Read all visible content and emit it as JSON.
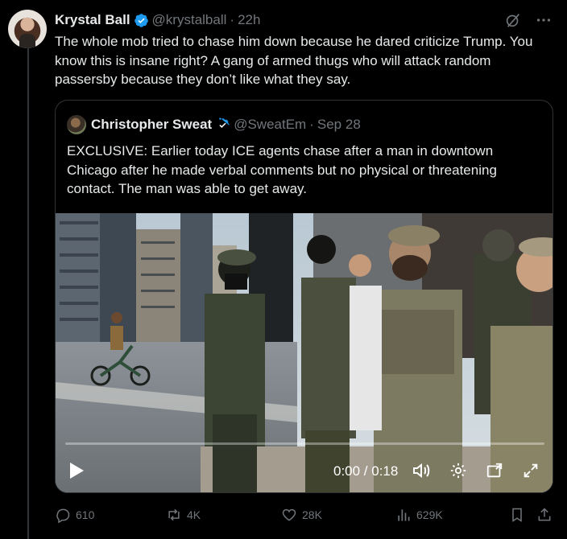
{
  "tweet": {
    "author_name": "Krystal Ball",
    "handle": "@krystalball",
    "separator": "·",
    "time": "22h",
    "text": "The whole mob tried to chase him down because he dared criticize Trump. You know this is insane right? A gang of armed thugs who will attack random passersby because they don’t like what they say."
  },
  "quote": {
    "author_name": "Christopher Sweat",
    "handle": "@SweatEm",
    "separator": "·",
    "date": "Sep 28",
    "text": "EXCLUSIVE: Earlier today ICE agents chase after a man in downtown Chicago after he made verbal comments but no physical or threatening contact. The man was able to get away.",
    "video": {
      "time_display": "0:00 / 0:18",
      "progress": 0
    }
  },
  "actions": {
    "replies": "610",
    "reposts": "4K",
    "likes": "28K",
    "views": "629K"
  },
  "icons": {
    "verified": "verified-badge-icon",
    "grok": "grok-icon",
    "more": "more-icon",
    "reply": "reply-icon",
    "repost": "repost-icon",
    "like": "like-icon",
    "views": "views-icon",
    "bookmark": "bookmark-icon",
    "share": "share-icon"
  },
  "colors": {
    "background": "#000000",
    "text": "#e7e9ea",
    "muted": "#71767b",
    "verified": "#1d9bf0",
    "border": "#2f3336"
  }
}
